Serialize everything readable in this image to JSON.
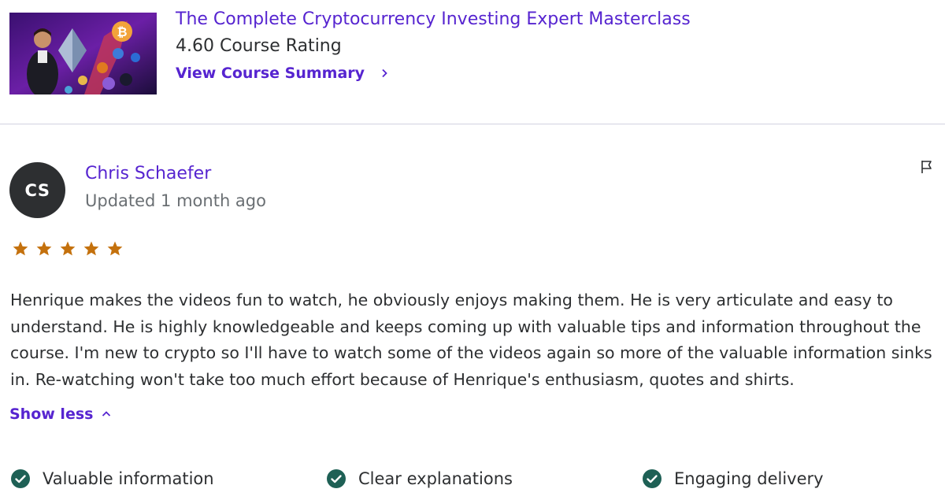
{
  "course": {
    "title": "The Complete Cryptocurrency Investing Expert Masterclass",
    "rating_text": "4.60 Course Rating",
    "summary_link": "View Course Summary",
    "thumbnail_icon": "course-thumbnail-image"
  },
  "review": {
    "avatar_initials": "CS",
    "reviewer_name": "Chris Schaefer",
    "date": "Updated 1 month ago",
    "rating": 5,
    "rating_max": 5,
    "text": "Henrique makes the videos fun to watch, he obviously enjoys making them. He is very articulate and easy to understand. He is highly knowledgeable and keeps coming up with valuable tips and information throughout the course. I'm new to crypto so I'll have to watch some of the videos again so more of the valuable information sinks in. Re-watching won't take too much effort because of Henrique's enthusiasm, quotes and shirts.",
    "show_less": "Show less",
    "tags": [
      "Valuable information",
      "Clear explanations",
      "Engaging delivery"
    ]
  },
  "colors": {
    "accent": "#5624d0",
    "star": "#c4710d",
    "check": "#1e6055",
    "text": "#2d2f31",
    "muted": "#6a6f73"
  }
}
